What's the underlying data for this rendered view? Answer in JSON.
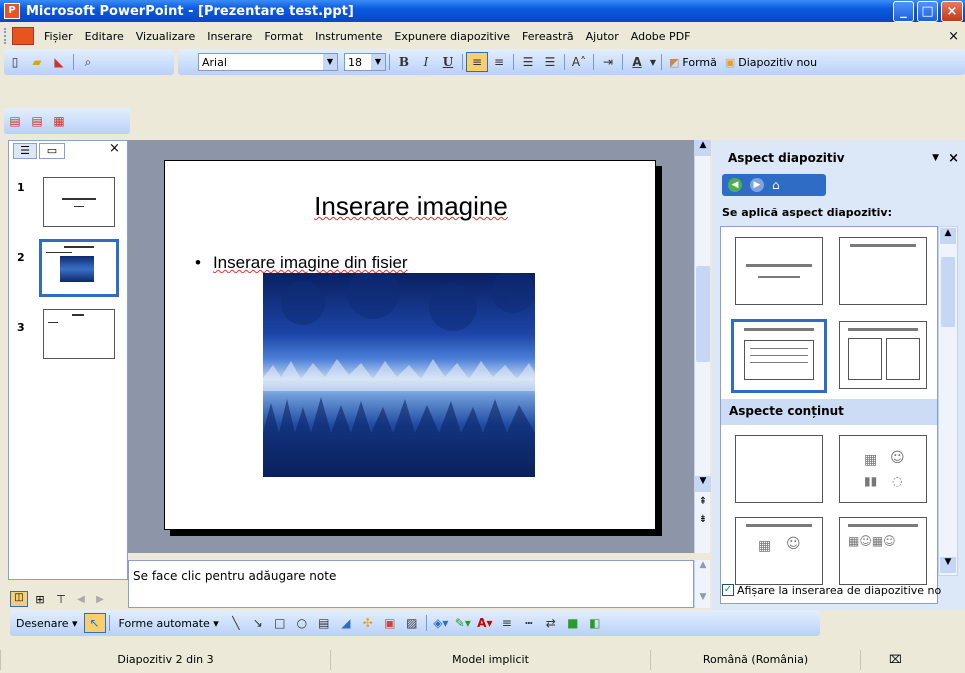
{
  "window": {
    "title": "Microsoft PowerPoint - [Prezentare test.ppt]"
  },
  "menu": {
    "items": [
      "Fișier",
      "Editare",
      "Vizualizare",
      "Inserare",
      "Format",
      "Instrumente",
      "Expunere diapozitive",
      "Fereastră",
      "Ajutor",
      "Adobe PDF"
    ]
  },
  "formatting": {
    "font": "Arial",
    "size": "18",
    "bold": "B",
    "italic": "I",
    "underline": "U",
    "design_label": "Formă",
    "new_slide_label": "Diapozitiv nou"
  },
  "outline_tabs": {
    "close": "×"
  },
  "thumbnails": [
    {
      "num": "1"
    },
    {
      "num": "2"
    },
    {
      "num": "3"
    }
  ],
  "slide": {
    "title": "Inserare imagine",
    "bullet": "Inserare imagine din fisier"
  },
  "taskpane": {
    "title": "Aspect diapozitiv",
    "apply_label": "Se aplică aspect diapozitiv:",
    "content_header": "Aspecte conținut",
    "checkbox_label": "Afișare la inserarea de diapozitive no"
  },
  "notes": {
    "text": "Se face clic pentru adăugare note"
  },
  "drawing": {
    "draw_label": "Desenare",
    "autoshapes_label": "Forme automate"
  },
  "status": {
    "slide_info": "Diapozitiv 2 din 3",
    "design": "Model implicit",
    "language": "Română (România)"
  },
  "colors": {
    "titlebar": "#0a5ae0",
    "toolbar": "#c4dafa",
    "selection": "#2e6cc6",
    "taskpane_header": "#ccdcf5"
  }
}
